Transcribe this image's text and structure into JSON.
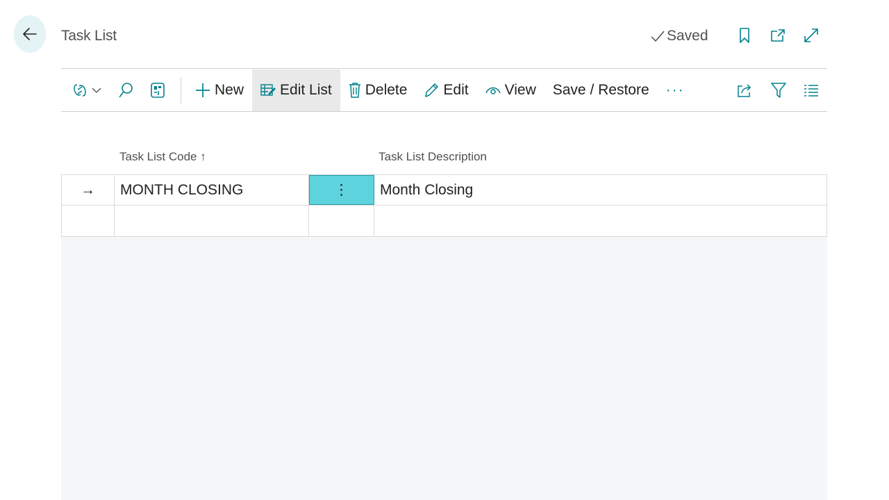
{
  "header": {
    "title": "Task List",
    "saved_label": "Saved"
  },
  "toolbar": {
    "new_label": "New",
    "edit_list_label": "Edit List",
    "delete_label": "Delete",
    "edit_label": "Edit",
    "view_label": "View",
    "save_restore_label": "Save / Restore",
    "more_label": "···"
  },
  "table": {
    "columns": [
      {
        "label": "Task List Code",
        "sort": "↑"
      },
      {
        "label": "Task List Description"
      }
    ],
    "rows": [
      {
        "selector": "→",
        "code": "MONTH CLOSING",
        "menu": "⋮",
        "description": "Month Closing"
      },
      {
        "selector": "",
        "code": "",
        "menu": "",
        "description": ""
      }
    ]
  },
  "colors": {
    "accent": "#00808b",
    "active_cell": "#5dd3dd",
    "back_button_bg": "#e4f3f5"
  }
}
